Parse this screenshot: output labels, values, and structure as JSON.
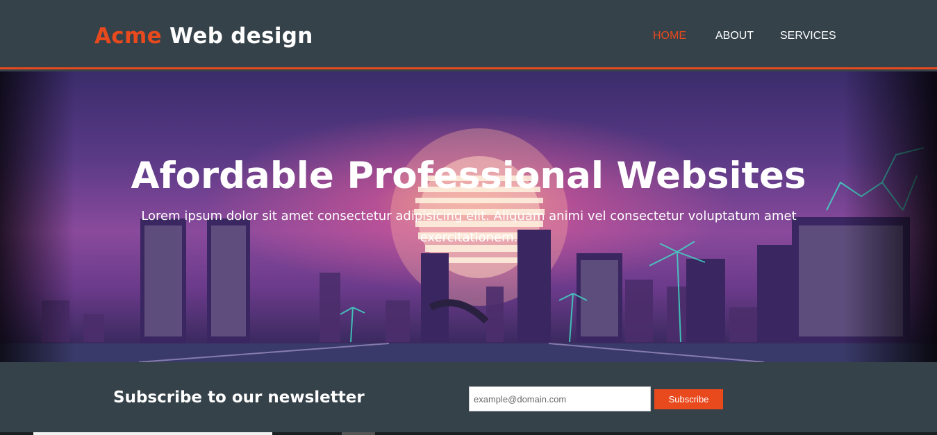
{
  "header": {
    "brand_highlight": "Acme",
    "brand_rest": " Web design",
    "nav": [
      {
        "label": "HOME",
        "active": true
      },
      {
        "label": "ABOUT",
        "active": false
      },
      {
        "label": "SERVICES",
        "active": false
      }
    ]
  },
  "showcase": {
    "title": "Afordable Professional Websites",
    "text": "Lorem ipsum dolor sit amet consectetur adipisicing elit. Aliquam animi vel consectetur voluptatum amet exercitationem.",
    "image": "synthwave-city-skyline-image"
  },
  "newsletter": {
    "heading": "Subscribe to our newsletter",
    "email_placeholder": "example@domain.com",
    "subscribe_label": "Subscribe"
  },
  "colors": {
    "header_bg": "#35424a",
    "accent": "#e8491d",
    "text": "#ffffff"
  }
}
